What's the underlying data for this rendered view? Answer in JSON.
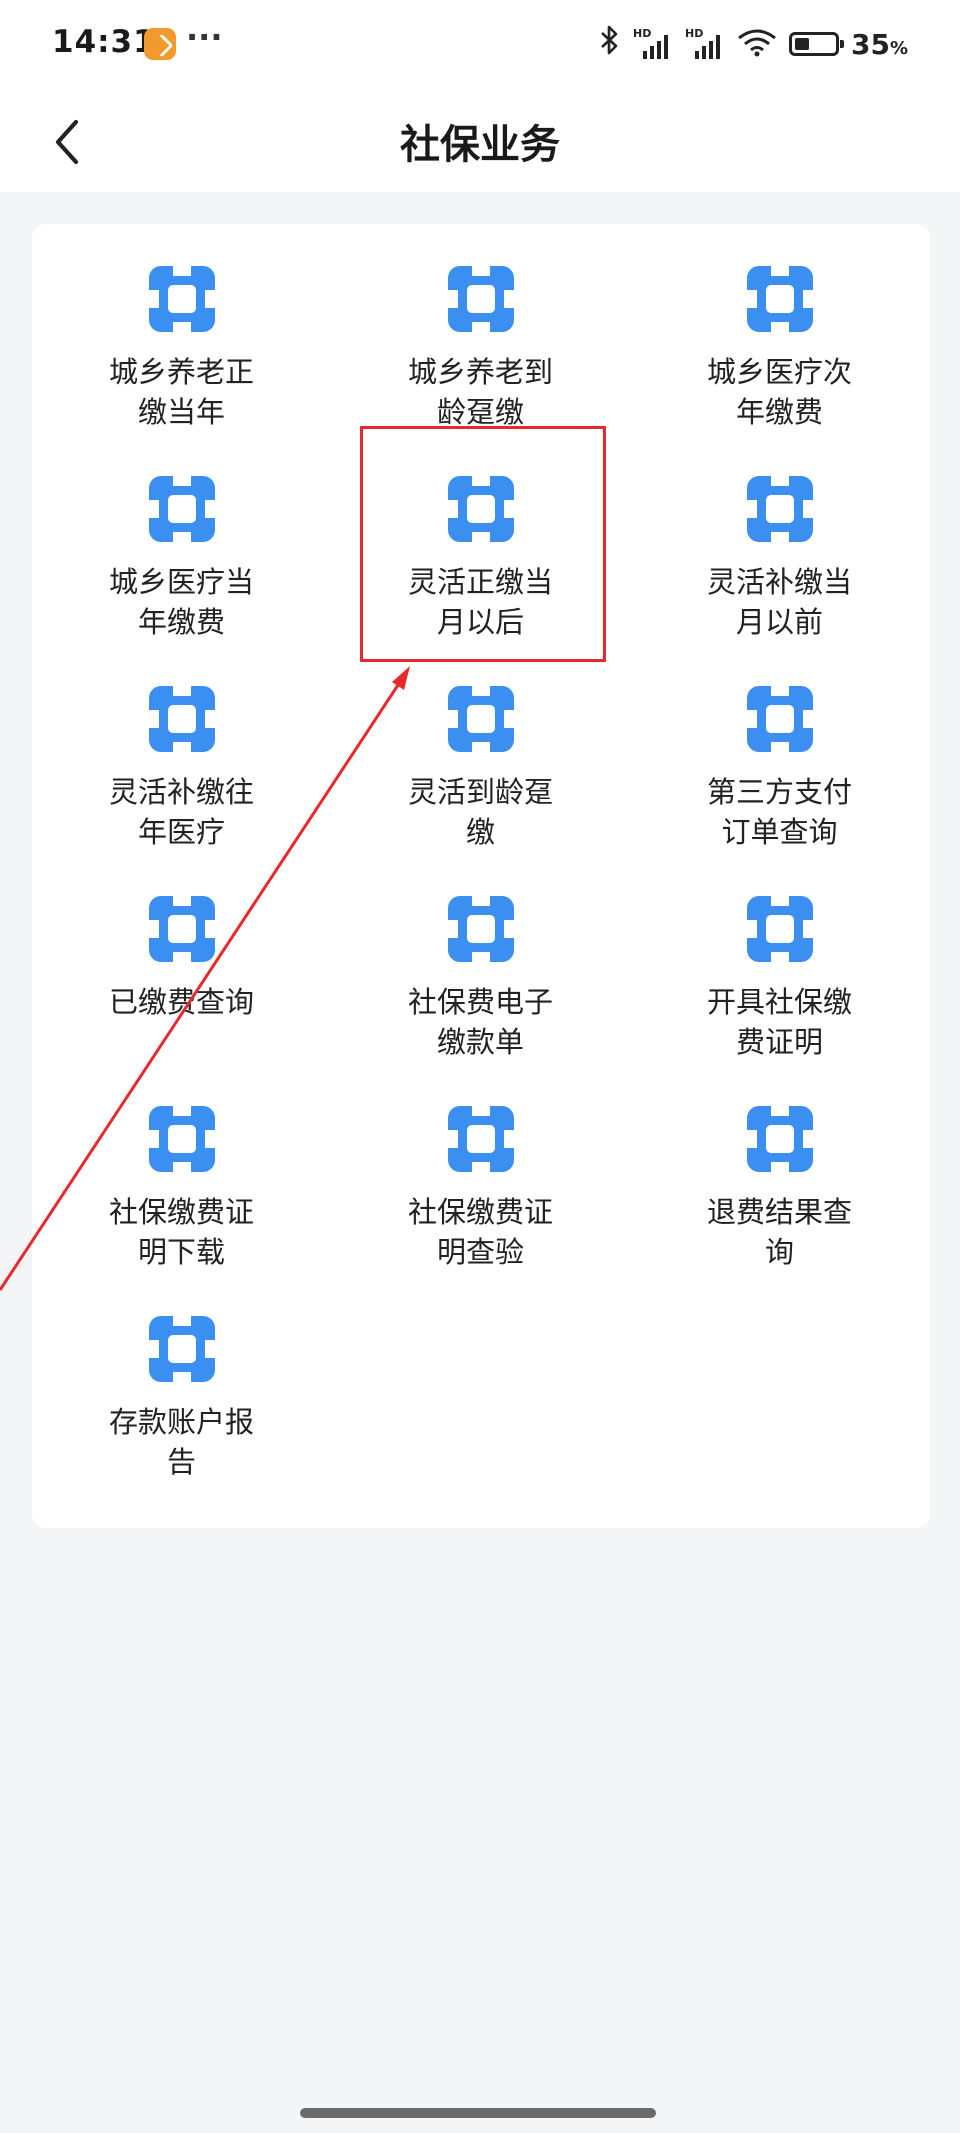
{
  "status_bar": {
    "time": "14:31",
    "battery_text": "35",
    "battery_unit": "%",
    "signal_label_1": "HD",
    "signal_label_2": "HD",
    "icons": [
      "app-icon",
      "more-dots-icon",
      "bluetooth-icon",
      "signal-icon",
      "signal-icon",
      "wifi-icon",
      "battery-icon"
    ]
  },
  "header": {
    "title": "社保业务",
    "back_icon": "back-chevron-icon"
  },
  "grid_items": [
    {
      "label": "城乡养老正缴当年"
    },
    {
      "label": "城乡养老到龄趸缴"
    },
    {
      "label": "城乡医疗次年缴费"
    },
    {
      "label": "城乡医疗当年缴费"
    },
    {
      "label": "灵活正缴当月以后"
    },
    {
      "label": "灵活补缴当月以前"
    },
    {
      "label": "灵活补缴往年医疗"
    },
    {
      "label": "灵活到龄趸缴"
    },
    {
      "label": "第三方支付订单查询"
    },
    {
      "label": "已缴费查询"
    },
    {
      "label": "社保费电子缴款单"
    },
    {
      "label": "开具社保缴费证明"
    },
    {
      "label": "社保缴费证明下载"
    },
    {
      "label": "社保缴费证明查验"
    },
    {
      "label": "退费结果查询"
    },
    {
      "label": "存款账户报告"
    }
  ],
  "colors": {
    "icon_blue": "#3b8ff0",
    "highlight_red": "#e8292b",
    "background": "#f4f5f7"
  }
}
